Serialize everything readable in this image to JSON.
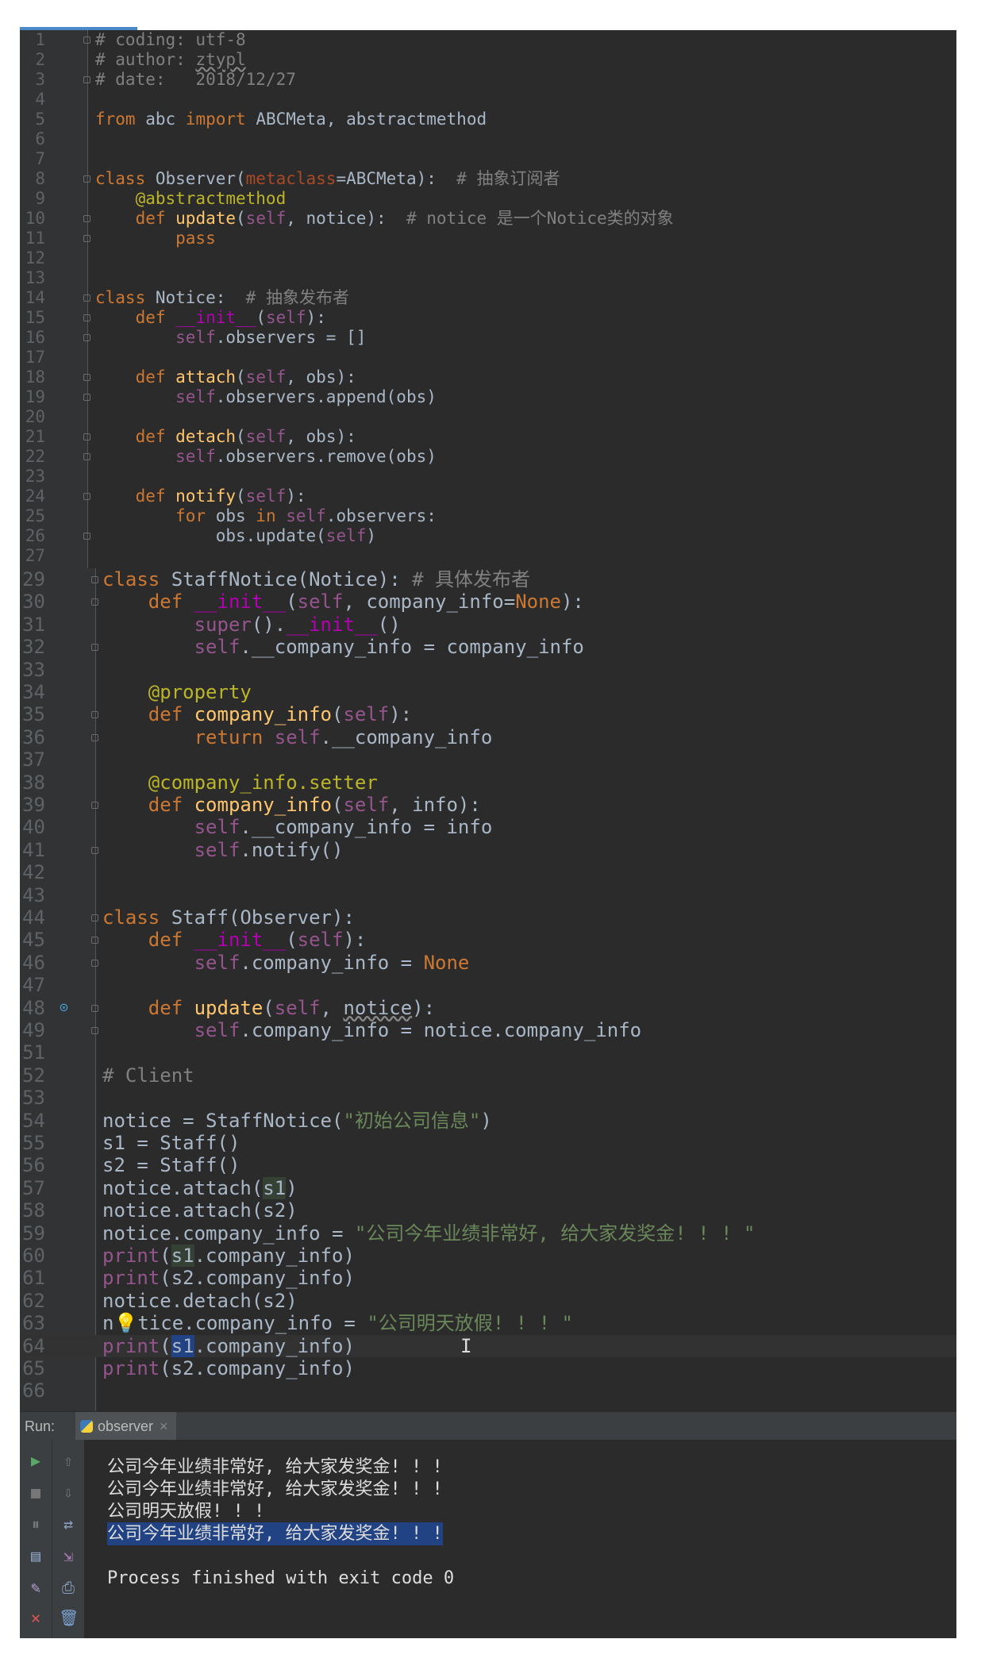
{
  "editor_top": {
    "lines": [
      {
        "n": "1",
        "segs": [
          {
            "t": "# coding: utf-8",
            "c": "cm"
          }
        ]
      },
      {
        "n": "2",
        "segs": [
          {
            "t": "# author: ",
            "c": "cm"
          },
          {
            "t": "ztypl",
            "c": "cm wavy"
          }
        ]
      },
      {
        "n": "3",
        "segs": [
          {
            "t": "# date:   2018/12/27",
            "c": "cm"
          }
        ]
      },
      {
        "n": "4",
        "segs": []
      },
      {
        "n": "5",
        "segs": [
          {
            "t": "from ",
            "c": "kw"
          },
          {
            "t": "abc ",
            "c": ""
          },
          {
            "t": "import ",
            "c": "kw"
          },
          {
            "t": "ABCMeta, abstractmethod",
            "c": ""
          }
        ]
      },
      {
        "n": "6",
        "segs": []
      },
      {
        "n": "7",
        "segs": []
      },
      {
        "n": "8",
        "segs": [
          {
            "t": "class ",
            "c": "kw"
          },
          {
            "t": "Observer(",
            "c": ""
          },
          {
            "t": "metaclass",
            "c": "pm"
          },
          {
            "t": "=ABCMeta):",
            "c": ""
          },
          {
            "t": "  # 抽象订阅者",
            "c": "cm"
          }
        ]
      },
      {
        "n": "9",
        "segs": [
          {
            "t": "    @abstractmethod",
            "c": "dc"
          }
        ]
      },
      {
        "n": "10",
        "segs": [
          {
            "t": "    def ",
            "c": "kw"
          },
          {
            "t": "update",
            "c": "fn"
          },
          {
            "t": "(",
            "c": ""
          },
          {
            "t": "self",
            "c": "sf"
          },
          {
            "t": ", notice):",
            "c": ""
          },
          {
            "t": "  # notice 是一个Notice类的对象",
            "c": "cm"
          }
        ]
      },
      {
        "n": "11",
        "segs": [
          {
            "t": "        pass",
            "c": "kw"
          }
        ]
      },
      {
        "n": "12",
        "segs": []
      },
      {
        "n": "13",
        "segs": []
      },
      {
        "n": "14",
        "segs": [
          {
            "t": "class ",
            "c": "kw"
          },
          {
            "t": "Notice:",
            "c": ""
          },
          {
            "t": "  # 抽象发布者",
            "c": "cm"
          }
        ]
      },
      {
        "n": "15",
        "segs": [
          {
            "t": "    def ",
            "c": "kw"
          },
          {
            "t": "__init__",
            "c": "dn"
          },
          {
            "t": "(",
            "c": ""
          },
          {
            "t": "self",
            "c": "sf"
          },
          {
            "t": "):",
            "c": ""
          }
        ]
      },
      {
        "n": "16",
        "segs": [
          {
            "t": "        ",
            "c": ""
          },
          {
            "t": "self",
            "c": "sf"
          },
          {
            "t": ".observers = []",
            "c": ""
          }
        ]
      },
      {
        "n": "17",
        "segs": []
      },
      {
        "n": "18",
        "segs": [
          {
            "t": "    def ",
            "c": "kw"
          },
          {
            "t": "attach",
            "c": "fn"
          },
          {
            "t": "(",
            "c": ""
          },
          {
            "t": "self",
            "c": "sf"
          },
          {
            "t": ", obs):",
            "c": ""
          }
        ]
      },
      {
        "n": "19",
        "segs": [
          {
            "t": "        ",
            "c": ""
          },
          {
            "t": "self",
            "c": "sf"
          },
          {
            "t": ".observers.append(obs)",
            "c": ""
          }
        ]
      },
      {
        "n": "20",
        "segs": []
      },
      {
        "n": "21",
        "segs": [
          {
            "t": "    def ",
            "c": "kw"
          },
          {
            "t": "detach",
            "c": "fn"
          },
          {
            "t": "(",
            "c": ""
          },
          {
            "t": "self",
            "c": "sf"
          },
          {
            "t": ", obs):",
            "c": ""
          }
        ]
      },
      {
        "n": "22",
        "segs": [
          {
            "t": "        ",
            "c": ""
          },
          {
            "t": "self",
            "c": "sf"
          },
          {
            "t": ".observers.remove(obs)",
            "c": ""
          }
        ]
      },
      {
        "n": "23",
        "segs": []
      },
      {
        "n": "24",
        "segs": [
          {
            "t": "    def ",
            "c": "kw"
          },
          {
            "t": "notify",
            "c": "fn"
          },
          {
            "t": "(",
            "c": ""
          },
          {
            "t": "self",
            "c": "sf"
          },
          {
            "t": "):",
            "c": ""
          }
        ]
      },
      {
        "n": "25",
        "segs": [
          {
            "t": "        for ",
            "c": "kw"
          },
          {
            "t": "obs ",
            "c": ""
          },
          {
            "t": "in ",
            "c": "kw"
          },
          {
            "t": "self",
            "c": "sf"
          },
          {
            "t": ".observers:",
            "c": ""
          }
        ]
      },
      {
        "n": "26",
        "segs": [
          {
            "t": "            obs.update(",
            "c": ""
          },
          {
            "t": "self",
            "c": "sf"
          },
          {
            "t": ")",
            "c": ""
          }
        ]
      },
      {
        "n": "27",
        "segs": []
      }
    ]
  },
  "editor_bottom": {
    "lines": [
      {
        "n": "29",
        "segs": [
          {
            "t": "class ",
            "c": "kw"
          },
          {
            "t": "StaffNotice(Notice):",
            "c": ""
          },
          {
            "t": " # 具体发布者",
            "c": "cm"
          }
        ]
      },
      {
        "n": "30",
        "segs": [
          {
            "t": "    def ",
            "c": "kw"
          },
          {
            "t": "__init__",
            "c": "dn"
          },
          {
            "t": "(",
            "c": ""
          },
          {
            "t": "self",
            "c": "sf"
          },
          {
            "t": ", company_info=",
            "c": ""
          },
          {
            "t": "None",
            "c": "kw"
          },
          {
            "t": "):",
            "c": ""
          }
        ]
      },
      {
        "n": "31",
        "segs": [
          {
            "t": "        ",
            "c": ""
          },
          {
            "t": "super",
            "c": "sf"
          },
          {
            "t": "().",
            "c": ""
          },
          {
            "t": "__init__",
            "c": "dn"
          },
          {
            "t": "()",
            "c": ""
          }
        ]
      },
      {
        "n": "32",
        "segs": [
          {
            "t": "        ",
            "c": ""
          },
          {
            "t": "self",
            "c": "sf"
          },
          {
            "t": ".__company_info = company_info",
            "c": ""
          }
        ]
      },
      {
        "n": "33",
        "segs": []
      },
      {
        "n": "34",
        "segs": [
          {
            "t": "    @property",
            "c": "dc"
          }
        ]
      },
      {
        "n": "35",
        "segs": [
          {
            "t": "    def ",
            "c": "kw"
          },
          {
            "t": "company_info",
            "c": "fn"
          },
          {
            "t": "(",
            "c": ""
          },
          {
            "t": "self",
            "c": "sf"
          },
          {
            "t": "):",
            "c": ""
          }
        ]
      },
      {
        "n": "36",
        "segs": [
          {
            "t": "        return ",
            "c": "kw"
          },
          {
            "t": "self",
            "c": "sf"
          },
          {
            "t": ".__company_info",
            "c": ""
          }
        ]
      },
      {
        "n": "37",
        "segs": []
      },
      {
        "n": "38",
        "segs": [
          {
            "t": "    @company_info.setter",
            "c": "dc"
          }
        ]
      },
      {
        "n": "39",
        "segs": [
          {
            "t": "    def ",
            "c": "kw"
          },
          {
            "t": "company_info",
            "c": "fn"
          },
          {
            "t": "(",
            "c": ""
          },
          {
            "t": "self",
            "c": "sf"
          },
          {
            "t": ", info):",
            "c": ""
          }
        ]
      },
      {
        "n": "40",
        "segs": [
          {
            "t": "        ",
            "c": ""
          },
          {
            "t": "self",
            "c": "sf"
          },
          {
            "t": ".__company_info = info",
            "c": ""
          }
        ]
      },
      {
        "n": "41",
        "segs": [
          {
            "t": "        ",
            "c": ""
          },
          {
            "t": "self",
            "c": "sf"
          },
          {
            "t": ".notify()",
            "c": ""
          }
        ]
      },
      {
        "n": "42",
        "segs": []
      },
      {
        "n": "43",
        "segs": []
      },
      {
        "n": "44",
        "segs": [
          {
            "t": "class ",
            "c": "kw"
          },
          {
            "t": "Staff(Observer):",
            "c": ""
          }
        ]
      },
      {
        "n": "45",
        "segs": [
          {
            "t": "    def ",
            "c": "kw"
          },
          {
            "t": "__init__",
            "c": "dn"
          },
          {
            "t": "(",
            "c": ""
          },
          {
            "t": "self",
            "c": "sf"
          },
          {
            "t": "):",
            "c": ""
          }
        ]
      },
      {
        "n": "46",
        "segs": [
          {
            "t": "        ",
            "c": ""
          },
          {
            "t": "self",
            "c": "sf"
          },
          {
            "t": ".company_info = ",
            "c": ""
          },
          {
            "t": "None",
            "c": "kw"
          }
        ]
      },
      {
        "n": "47",
        "segs": []
      },
      {
        "n": "48",
        "segs": [
          {
            "t": "    def ",
            "c": "kw"
          },
          {
            "t": "update",
            "c": "fn"
          },
          {
            "t": "(",
            "c": ""
          },
          {
            "t": "self",
            "c": "sf"
          },
          {
            "t": ", ",
            "c": ""
          },
          {
            "t": "notice",
            "c": "wavy"
          },
          {
            "t": "):",
            "c": ""
          }
        ]
      },
      {
        "n": "49",
        "segs": [
          {
            "t": "        ",
            "c": ""
          },
          {
            "t": "self",
            "c": "sf"
          },
          {
            "t": ".company_info = notice.company_info",
            "c": ""
          }
        ]
      },
      {
        "n": "51",
        "segs": []
      },
      {
        "n": "52",
        "segs": [
          {
            "t": "# Client",
            "c": "cm"
          }
        ]
      },
      {
        "n": "53",
        "segs": []
      },
      {
        "n": "54",
        "segs": [
          {
            "t": "notice = StaffNotice(",
            "c": ""
          },
          {
            "t": "\"初始公司信息\"",
            "c": "st"
          },
          {
            "t": ")",
            "c": ""
          }
        ]
      },
      {
        "n": "55",
        "segs": [
          {
            "t": "s1 = Staff()",
            "c": ""
          }
        ]
      },
      {
        "n": "56",
        "segs": [
          {
            "t": "s2 = Staff()",
            "c": ""
          }
        ]
      },
      {
        "n": "57",
        "segs": [
          {
            "t": "notice.attach(",
            "c": ""
          },
          {
            "t": "s1",
            "c": "hl"
          },
          {
            "t": ")",
            "c": ""
          }
        ]
      },
      {
        "n": "58",
        "segs": [
          {
            "t": "notice.attach(s2)",
            "c": ""
          }
        ]
      },
      {
        "n": "59",
        "segs": [
          {
            "t": "notice.company_info = ",
            "c": ""
          },
          {
            "t": "\"公司今年业绩非常好, 给大家发奖金! ! ! \"",
            "c": "st"
          }
        ]
      },
      {
        "n": "60",
        "segs": [
          {
            "t": "print",
            "c": "sf"
          },
          {
            "t": "(",
            "c": ""
          },
          {
            "t": "s1",
            "c": "hl"
          },
          {
            "t": ".company_info)",
            "c": ""
          }
        ]
      },
      {
        "n": "61",
        "segs": [
          {
            "t": "print",
            "c": "sf"
          },
          {
            "t": "(s2.company_info)",
            "c": ""
          }
        ]
      },
      {
        "n": "62",
        "segs": [
          {
            "t": "notice.detach(s2)",
            "c": ""
          }
        ]
      },
      {
        "n": "63",
        "segs": [
          {
            "t": "n",
            "c": ""
          },
          {
            "t": "💡",
            "c": "bulb"
          },
          {
            "t": "tice.company_info = ",
            "c": ""
          },
          {
            "t": "\"公司明天放假! ! ! \"",
            "c": "st"
          }
        ]
      },
      {
        "n": "64",
        "segs": [
          {
            "t": "print",
            "c": "sf"
          },
          {
            "t": "(",
            "c": ""
          },
          {
            "t": "s1",
            "c": "sel"
          },
          {
            "t": ".company_info)",
            "c": ""
          }
        ]
      },
      {
        "n": "65",
        "segs": [
          {
            "t": "print",
            "c": "sf"
          },
          {
            "t": "(s2.company_info)",
            "c": ""
          }
        ]
      },
      {
        "n": "66",
        "segs": []
      }
    ]
  },
  "run_panel": {
    "label": "Run:",
    "tab_name": "observer",
    "tab_close": "×",
    "output": [
      "公司今年业绩非常好, 给大家发奖金! ! !",
      "公司今年业绩非常好, 给大家发奖金! ! !",
      "公司明天放假! ! !",
      "公司今年业绩非常好, 给大家发奖金! ! !",
      "",
      "Process finished with exit code 0"
    ]
  },
  "colors": {
    "editor_bg": "#2b2b2b",
    "gutter_bg": "#313335",
    "keyword": "#cc7832",
    "string": "#6a8759",
    "comment": "#808080",
    "selection": "#214283"
  }
}
